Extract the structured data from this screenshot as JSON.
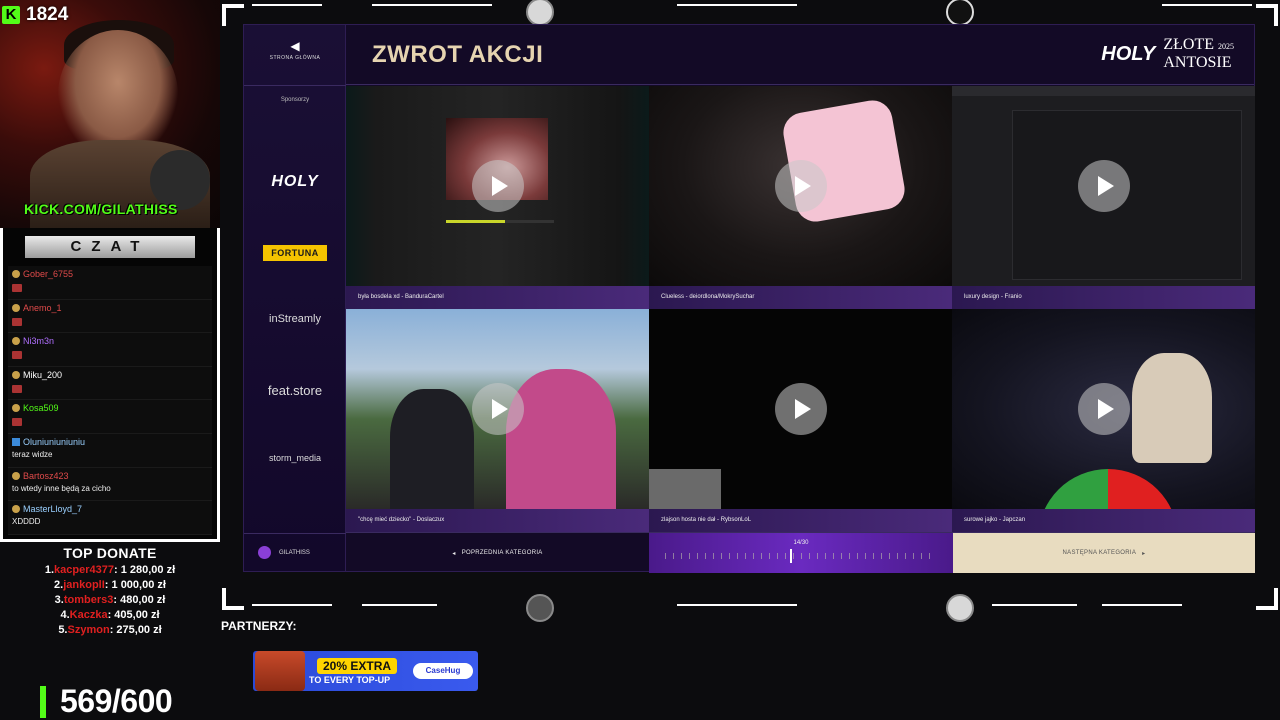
{
  "stream": {
    "viewer_count": "1824",
    "channel_url": "KICK.COM/GILATHISS"
  },
  "chat": {
    "title": "CZAT",
    "messages": [
      {
        "user": "Gober_6755",
        "user_color": "#e04a4a",
        "text": ""
      },
      {
        "user": "Anemo_1",
        "user_color": "#e04a4a",
        "text": ""
      },
      {
        "user": "Ni3m3n",
        "user_color": "#b070ff",
        "text": ""
      },
      {
        "user": "Miku_200",
        "user_color": "#ffffff",
        "text": ""
      },
      {
        "user": "Kosa509",
        "user_color": "#53fc18",
        "text": ""
      },
      {
        "user": "Oluniuniuniuniu",
        "user_color": "#9ad0ff",
        "text": "teraz widze"
      },
      {
        "user": "Bartosz423",
        "user_color": "#e04a4a",
        "text": "to wtedy inne będą za cicho"
      },
      {
        "user": "MasterLloyd_7",
        "user_color": "#9ad0ff",
        "text": "XDDDD"
      }
    ]
  },
  "top_donate": {
    "title": "TOP DONATE",
    "donors": [
      {
        "rank": "1.",
        "name": "kacper4377",
        "amount": ": 1 280,00 zł"
      },
      {
        "rank": "2.",
        "name": "jankoplI",
        "amount": ": 1 000,00 zł"
      },
      {
        "rank": "3.",
        "name": "tombers3",
        "amount": ": 480,00 zł"
      },
      {
        "rank": "4.",
        "name": "Kaczka",
        "amount": ": 405,00 zł"
      },
      {
        "rank": "5.",
        "name": "Szymon",
        "amount": ": 275,00 zł"
      }
    ]
  },
  "goal": {
    "text": "569/600"
  },
  "dashboard": {
    "back_label": "STRONA GŁÓWNA",
    "title": "ZWROT AKCJI",
    "brand": {
      "holy": "HOLY",
      "line1": "ZŁOTE",
      "year": "2025",
      "line2": "ANTOSIE"
    },
    "sponsors_label": "Sponsorzy",
    "sponsors": [
      "HOLY",
      "FORTUNA",
      "inStreamly",
      "feat.store",
      "storm_media"
    ],
    "user": "GILATHISS",
    "tiles": [
      {
        "caption": "była bosdela xd - BanduraCartel",
        "progress": 0.55
      },
      {
        "caption": "Clueless - deiordlona/MokrySuchar"
      },
      {
        "caption": "luxury design - Franio"
      },
      {
        "caption": "\"chcę mieć dziecko\" - Doslaczux"
      },
      {
        "caption": "zlajson hosta nie dał - RybsonLoL"
      },
      {
        "caption": "surowe jajko - Japczan"
      }
    ],
    "prev_label": "POPRZEDNIA KATEGORIA",
    "next_label": "NASTĘPNA KATEGORIA",
    "page": "14/30",
    "page_fraction": 0.46
  },
  "partners": {
    "label": "PARTNERZY:",
    "ad_badge": "20% EXTRA",
    "ad_sub": "TO EVERY TOP-UP",
    "ad_brand": "CaseHug"
  }
}
